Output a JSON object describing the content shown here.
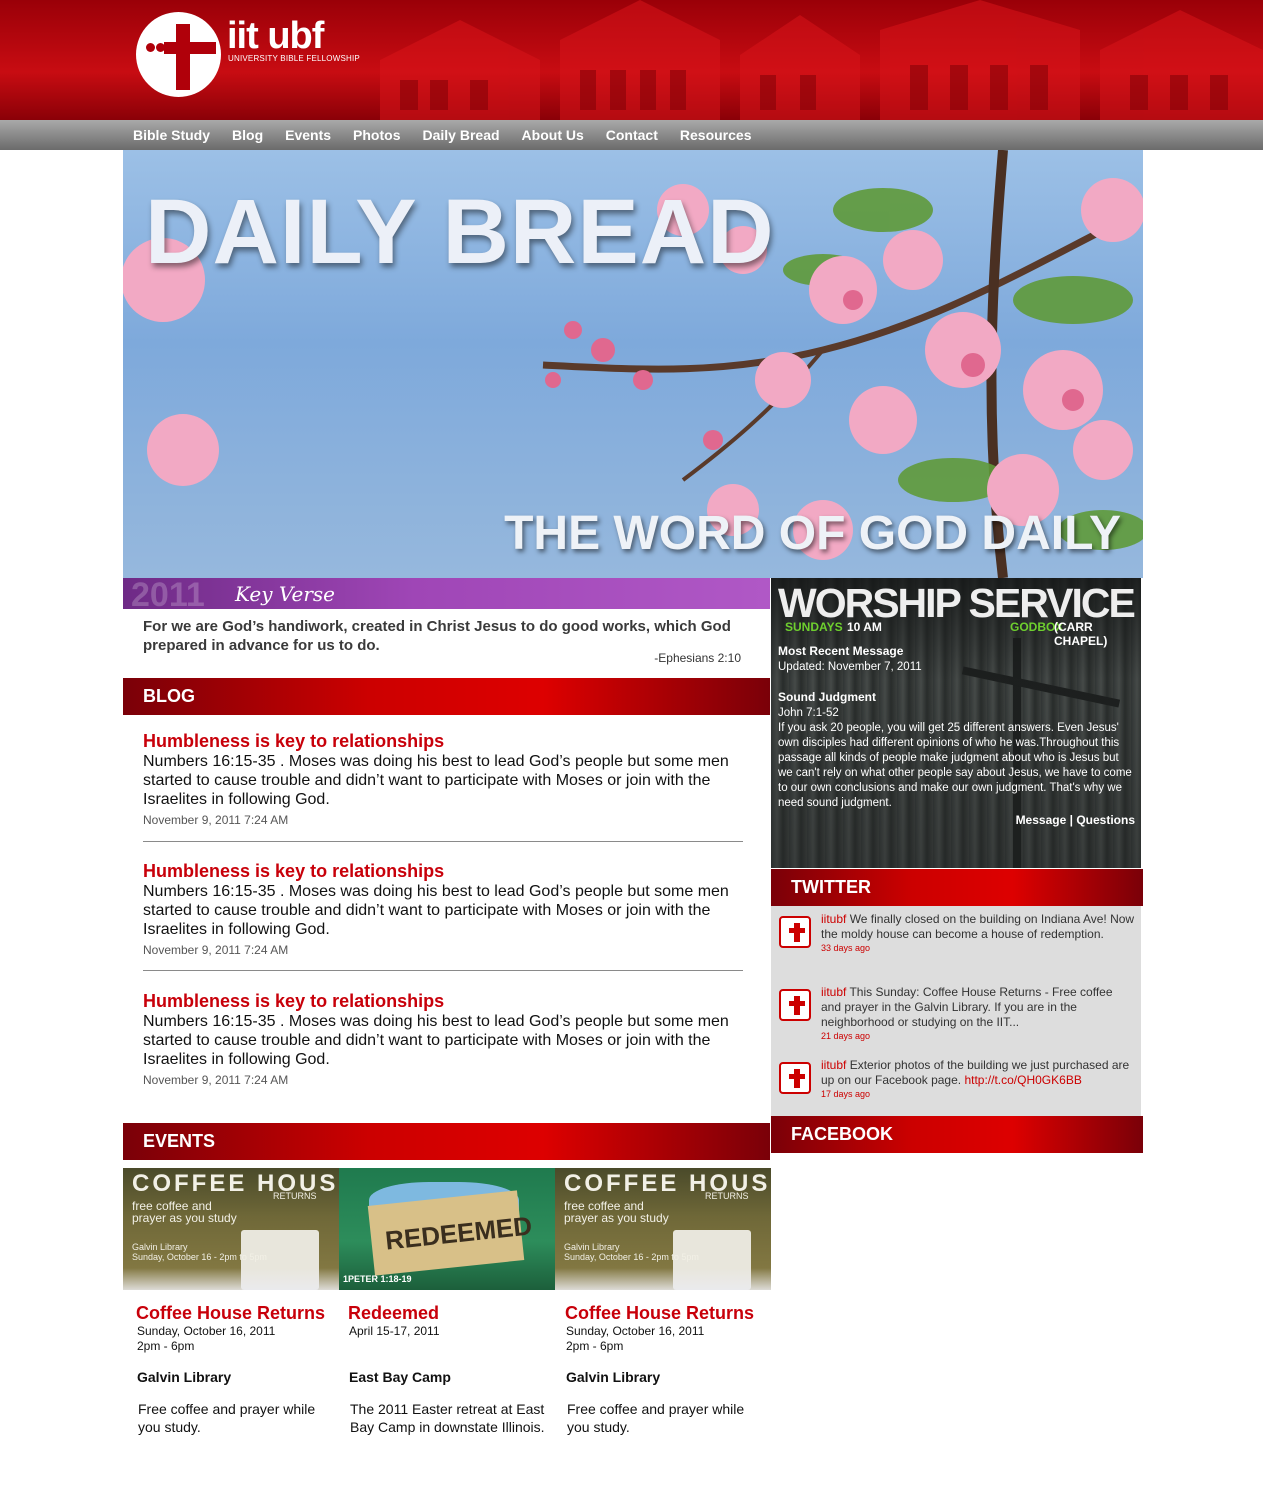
{
  "header": {
    "brand": "iit ubf",
    "brand_sub": "UNIVERSITY BIBLE FELLOWSHIP"
  },
  "nav": [
    "Bible Study",
    "Blog",
    "Events",
    "Photos",
    "Daily Bread",
    "About Us",
    "Contact",
    "Resources"
  ],
  "hero": {
    "title": "DAILY BREAD",
    "subtitle": "THE WORD OF GOD DAILY"
  },
  "key_verse": {
    "year": "2011",
    "label": "Key Verse",
    "text": "For we are God’s handiwork, created in Christ Jesus to do good works, which God prepared in advance for us to do.",
    "ref": "-Ephesians 2:10"
  },
  "blog": {
    "heading": "BLOG",
    "posts": [
      {
        "title": "Humbleness is key to relationships",
        "body": "Numbers 16:15-35 . Moses was doing his best to lead God’s people but some men started to cause trouble and didn’t want to participate with Moses or join with the Israelites in following God.",
        "date": "November 9, 2011 7:24 AM"
      },
      {
        "title": "Humbleness is key to relationships",
        "body": "Numbers 16:15-35 . Moses was doing his best to lead God’s people but some men started to cause trouble and didn’t want to participate with Moses or join with the Israelites in following God.",
        "date": "November 9, 2011 7:24 AM"
      },
      {
        "title": "Humbleness is key to relationships",
        "body": "Numbers 16:15-35 . Moses was doing his best to lead God’s people but some men started to cause trouble and didn’t want to participate with Moses or join with the Israelites in following God.",
        "date": "November 9, 2011 7:24 AM"
      }
    ]
  },
  "worship": {
    "title": "WORSHIP SERVICE",
    "day": "SUNDAYS",
    "time": "10 AM",
    "place": "GODBOX",
    "place_detail": "(CARR CHAPEL)",
    "recent_label": "Most Recent Message",
    "updated": "Updated: November 7, 2011",
    "message_title": "Sound Judgment",
    "passage": "John 7:1-52",
    "summary": "If you ask 20 people, you will get 25 different answers. Even Jesus' own disciples had different opinions of who he was.Throughout this passage all kinds of people make judgment about who is Jesus but we can't rely on what other people say about Jesus, we have to come to our own conclusions and make our own judgment. That's why we need sound judgment.",
    "link_message": "Message",
    "link_sep": "|",
    "link_questions": "Questions"
  },
  "twitter": {
    "heading": "TWITTER",
    "tweets": [
      {
        "user": "iitubf",
        "text": " We finally closed on the building on Indiana Ave! Now the moldy house can become a house of redemption.",
        "link": "",
        "ago": "33 days ago"
      },
      {
        "user": "iitubf",
        "text": " This Sunday: Coffee House Returns - Free coffee and prayer in the Galvin Library. If you are in the neighborhood or studying on the IIT...",
        "link": "",
        "ago": "21 days ago"
      },
      {
        "user": "iitubf",
        "text": " Exterior photos of the building we just purchased are up on our Facebook page. ",
        "link": "http://t.co/QH0GK6BB",
        "ago": "17 days ago"
      }
    ]
  },
  "facebook": {
    "heading": "FACEBOOK"
  },
  "events": {
    "heading": "EVENTS",
    "flyers": {
      "coffee_title": "COFFEE HOUSE",
      "coffee_returns": "RETURNS",
      "coffee_tagline": "free coffee and prayer as you study",
      "coffee_where": "Galvin Library",
      "coffee_when": "Sunday, October 16 - 2pm to 5pm",
      "redeemed_title": "REDEEMED",
      "redeemed_ref": "1PETER 1:18-19"
    },
    "items": [
      {
        "title": "Coffee House Returns",
        "date": "Sunday, October 16, 2011",
        "time": "2pm - 6pm",
        "location": "Galvin Library",
        "description": "Free coffee and prayer while you study."
      },
      {
        "title": "Redeemed",
        "date": "April 15-17, 2011",
        "time": "",
        "location": "East Bay Camp",
        "description": "The 2011 Easter retreat at East Bay Camp in downstate Illinois."
      },
      {
        "title": "Coffee House Returns",
        "date": "Sunday, October 16, 2011",
        "time": "2pm - 6pm",
        "location": "Galvin Library",
        "description": "Free coffee and prayer while you study."
      }
    ]
  },
  "colors": {
    "accent_red": "#c8000a",
    "nav_gray": "#8a8a8a",
    "keyverse_purple": "#9f46b6",
    "twitter_bg": "#dddddd",
    "worship_green": "#6ecf2e"
  }
}
